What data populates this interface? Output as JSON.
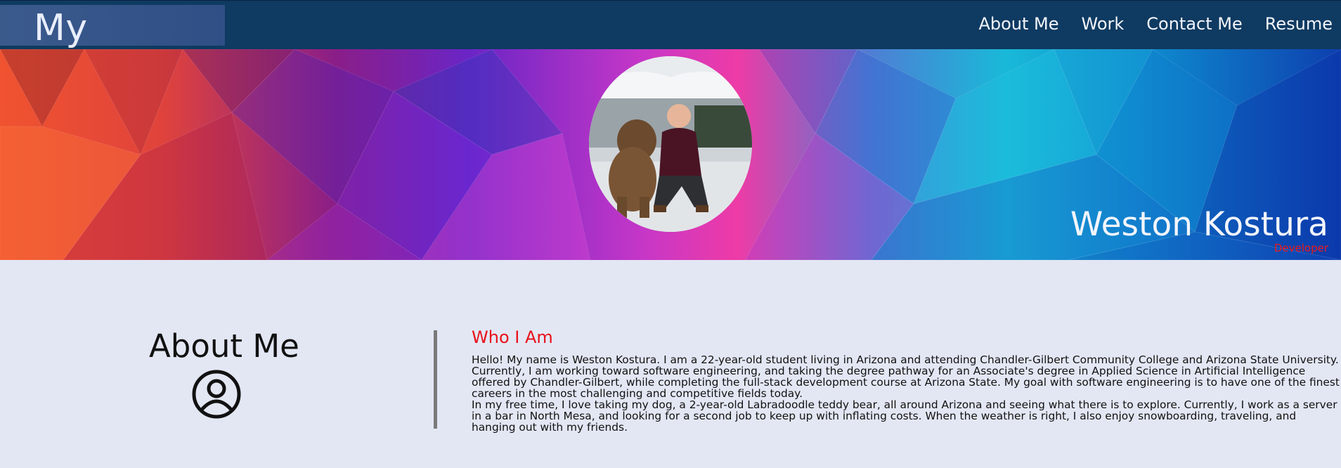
{
  "header": {
    "brand": "My Portfolio",
    "nav": [
      "About Me",
      "Work",
      "Contact Me",
      "Resume"
    ]
  },
  "hero": {
    "name": "Weston Kostura",
    "role": "Developer",
    "avatar_icon": "profile-photo"
  },
  "about": {
    "title": "About Me",
    "icon": "user-circle-icon",
    "who_title": "Who I Am",
    "paragraph1": "Hello! My name is Weston Kostura. I am a 22-year-old student living in Arizona and attending Chandler-Gilbert Community College and Arizona State University. Currently, I am working toward software engineering, and taking the degree pathway for an Associate's degree in Applied Science in Artificial Intelligence offered by Chandler-Gilbert, while completing the full-stack development course at Arizona State. My goal with software engineering is to have one of the finest careers in the most challenging and competitive fields today.",
    "paragraph2": "In my free time, I love taking my dog, a 2-year-old Labradoodle teddy bear, all around Arizona and seeing what there is to explore. Currently, I work as a server in a bar in North Mesa, and looking for a second job to keep up with inflating costs. When the weather is right, I also enjoy snowboarding, traveling, and hanging out with my friends."
  },
  "colors": {
    "header_bg": "#0f3a61",
    "page_bg": "#e3e7f4",
    "accent_red": "#e8101a"
  }
}
